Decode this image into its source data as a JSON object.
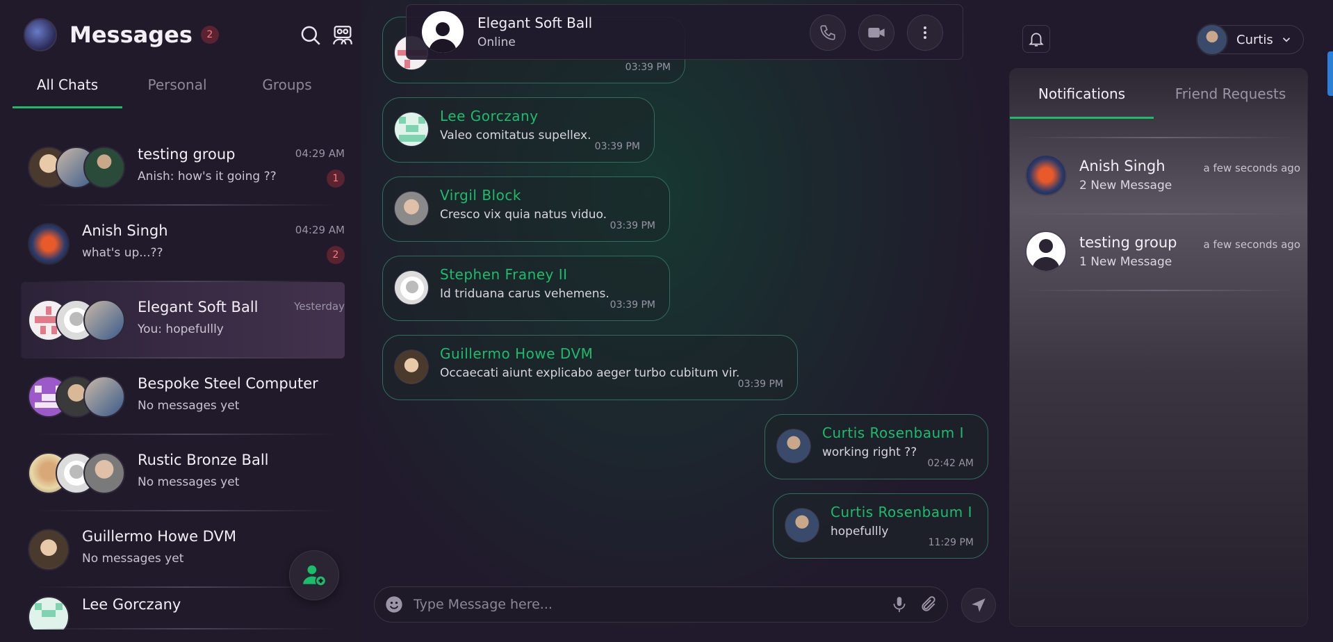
{
  "sidebar": {
    "title": "Messages",
    "unread_count": "2",
    "tabs": [
      "All Chats",
      "Personal",
      "Groups"
    ],
    "chats": [
      {
        "name": "testing group",
        "preview": "Anish: how's it going ??",
        "time": "04:29 AM",
        "unread": "1"
      },
      {
        "name": "Anish Singh",
        "preview": "what's up...??",
        "time": "04:29 AM",
        "unread": "2"
      },
      {
        "name": "Elegant Soft Ball",
        "preview": "You: hopefullly",
        "time": "Yesterday",
        "unread": ""
      },
      {
        "name": "Bespoke Steel Computer",
        "preview": "No messages yet",
        "time": "",
        "unread": ""
      },
      {
        "name": "Rustic Bronze Ball",
        "preview": "No messages yet",
        "time": "",
        "unread": ""
      },
      {
        "name": "Guillermo Howe DVM",
        "preview": "No messages yet",
        "time": "",
        "unread": ""
      },
      {
        "name": "Lee Gorczany",
        "preview": "",
        "time": "",
        "unread": ""
      }
    ]
  },
  "chat_header": {
    "name": "Elegant Soft Ball",
    "status": "Online"
  },
  "messages": [
    {
      "name": "",
      "body": "",
      "time": "03:39 PM"
    },
    {
      "name": "Lee Gorczany",
      "body": "Valeo comitatus supellex.",
      "time": "03:39 PM"
    },
    {
      "name": "Virgil Block",
      "body": "Cresco vix quia natus viduo.",
      "time": "03:39 PM"
    },
    {
      "name": "Stephen Franey II",
      "body": "Id triduana carus vehemens.",
      "time": "03:39 PM"
    },
    {
      "name": "Guillermo Howe DVM",
      "body": "Occaecati aiunt explicabo aeger turbo cubitum vir.",
      "time": "03:39 PM"
    },
    {
      "name": "Curtis Rosenbaum I",
      "body": "working right ??",
      "time": "02:42 AM"
    },
    {
      "name": "Curtis Rosenbaum I",
      "body": "hopefullly",
      "time": "11:29 PM"
    }
  ],
  "composer": {
    "placeholder": "Type Message here..."
  },
  "user": {
    "name": "Curtis"
  },
  "notifications": {
    "tabs": [
      "Notifications",
      "Friend Requests"
    ],
    "items": [
      {
        "name": "Anish Singh",
        "message": "2 New Message",
        "time": "a few seconds ago"
      },
      {
        "name": "testing group",
        "message": "1 New Message",
        "time": "a few seconds ago"
      }
    ]
  },
  "colors": {
    "accent": "#1bbd6c",
    "background": "#211a2c",
    "badge_bg": "#5a2330",
    "badge_text": "#ff7b86"
  },
  "icons": [
    "search-icon",
    "contacts-icon",
    "phone-icon",
    "video-icon",
    "more-vertical-icon",
    "emoji-icon",
    "mic-icon",
    "attach-icon",
    "send-icon",
    "bell-icon",
    "chevron-down-icon",
    "add-contact-icon"
  ]
}
